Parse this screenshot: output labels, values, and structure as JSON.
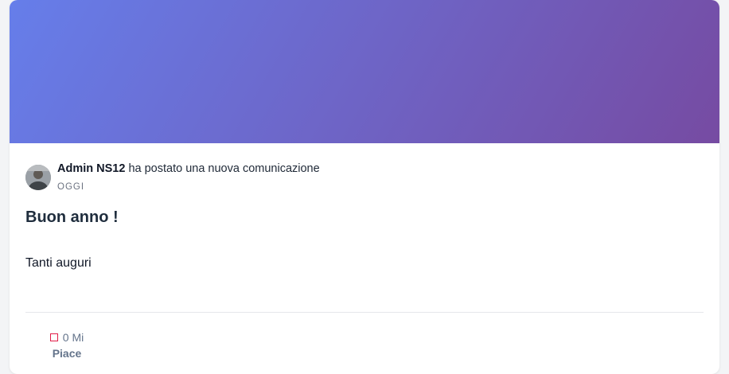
{
  "post": {
    "author_name": "Admin NS12",
    "action_text": "ha postato una nuova comunicazione",
    "date": "OGGI",
    "title": "Buon anno !",
    "body": "Tanti auguri"
  },
  "likes": {
    "count_text": "0 Mi",
    "label": "Piace"
  },
  "colors": {
    "gradient_start": "#667eea",
    "gradient_end": "#764ba2",
    "like_icon": "#e11d48"
  },
  "icons": {
    "like": "heart-icon"
  }
}
